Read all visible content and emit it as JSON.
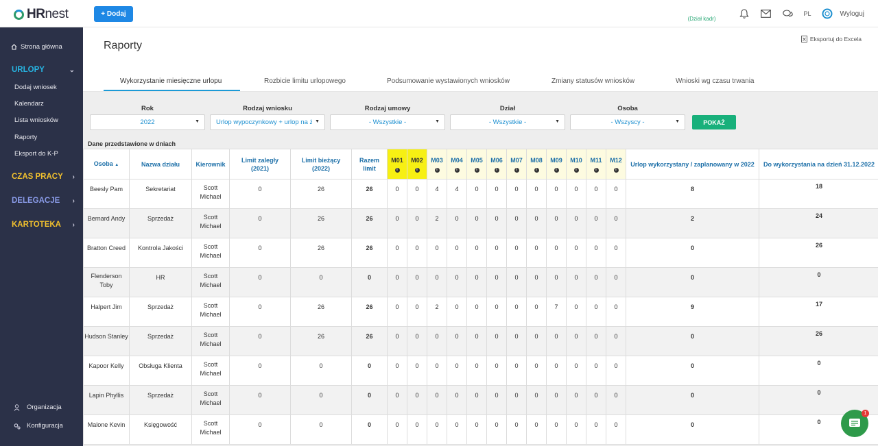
{
  "header": {
    "logo_bold": "HR",
    "logo_thin": "nest",
    "add_label": "+ Dodaj",
    "dzial_kadr": "(Dział kadr)",
    "lang": "PL",
    "logout": "Wyloguj"
  },
  "sidebar": {
    "home": "Strona główna",
    "urlopy": "URLOPY",
    "urlopy_items": [
      "Dodaj wniosek",
      "Kalendarz",
      "Lista wniosków",
      "Raporty",
      "Eksport do K-P"
    ],
    "czas_pracy": "CZAS PRACY",
    "delegacje": "DELEGACJE",
    "kartoteka": "KARTOTEKA",
    "organizacja": "Organizacja",
    "konfiguracja": "Konfiguracja"
  },
  "page": {
    "title": "Raporty",
    "export": "Eksportuj do Excela"
  },
  "tabs": [
    "Wykorzystanie miesięczne urlopu",
    "Rozbicie limitu urlopowego",
    "Podsumowanie wystawionych wniosków",
    "Zmiany statusów wniosków",
    "Wnioski wg czasu trwania"
  ],
  "filters": {
    "rok_label": "Rok",
    "rok_value": "2022",
    "rodzaj_wniosku_label": "Rodzaj wniosku",
    "rodzaj_wniosku_value": "Urlop wypoczynkowy + urlop na żą",
    "rodzaj_umowy_label": "Rodzaj umowy",
    "rodzaj_umowy_value": "- Wszystkie -",
    "dzial_label": "Dział",
    "dzial_value": "- Wszystkie -",
    "osoba_label": "Osoba",
    "osoba_value": "- Wszyscy -",
    "show_button": "POKAŻ"
  },
  "dane_label": "Dane przedstawione w dniach",
  "table": {
    "headers": {
      "osoba": "Osoba",
      "dzial": "Nazwa działu",
      "kierownik": "Kierownik",
      "limit_zalegly": "Limit zaległy",
      "limit_zalegly_year": "(2021)",
      "limit_biezacy": "Limit bieżący",
      "limit_biezacy_year": "(2022)",
      "razem": "Razem",
      "razem2": "limit",
      "months": [
        "M01",
        "M02",
        "M03",
        "M04",
        "M05",
        "M06",
        "M07",
        "M08",
        "M09",
        "M10",
        "M11",
        "M12"
      ],
      "wykorzystany": "Urlop wykorzystany / zaplanowany w 2022",
      "do_wykorzystania": "Do wykorzystania na dzień 31.12.2022"
    },
    "rows": [
      {
        "osoba": [
          "Beesly Pam"
        ],
        "dzial": "Sekretariat",
        "kier": [
          "Scott",
          "Michael"
        ],
        "lz": "0",
        "lb": "26",
        "razem": "26",
        "m": [
          "0",
          "0",
          "4",
          "4",
          "0",
          "0",
          "0",
          "0",
          "0",
          "0",
          "0",
          "0"
        ],
        "wyk": "8",
        "do": "18"
      },
      {
        "osoba": [
          "Bernard Andy"
        ],
        "dzial": "Sprzedaż",
        "kier": [
          "Scott",
          "Michael"
        ],
        "lz": "0",
        "lb": "26",
        "razem": "26",
        "m": [
          "0",
          "0",
          "2",
          "0",
          "0",
          "0",
          "0",
          "0",
          "0",
          "0",
          "0",
          "0"
        ],
        "wyk": "2",
        "do": "24"
      },
      {
        "osoba": [
          "Bratton Creed"
        ],
        "dzial": "Kontrola Jakości",
        "kier": [
          "Scott",
          "Michael"
        ],
        "lz": "0",
        "lb": "26",
        "razem": "26",
        "m": [
          "0",
          "0",
          "0",
          "0",
          "0",
          "0",
          "0",
          "0",
          "0",
          "0",
          "0",
          "0"
        ],
        "wyk": "0",
        "do": "26"
      },
      {
        "osoba": [
          "Flenderson",
          "Toby"
        ],
        "dzial": "HR",
        "kier": [
          "Scott",
          "Michael"
        ],
        "lz": "0",
        "lb": "0",
        "razem": "0",
        "m": [
          "0",
          "0",
          "0",
          "0",
          "0",
          "0",
          "0",
          "0",
          "0",
          "0",
          "0",
          "0"
        ],
        "wyk": "0",
        "do": "0"
      },
      {
        "osoba": [
          "Halpert Jim"
        ],
        "dzial": "Sprzedaż",
        "kier": [
          "Scott",
          "Michael"
        ],
        "lz": "0",
        "lb": "26",
        "razem": "26",
        "m": [
          "0",
          "0",
          "2",
          "0",
          "0",
          "0",
          "0",
          "0",
          "7",
          "0",
          "0",
          "0"
        ],
        "wyk": "9",
        "do": "17"
      },
      {
        "osoba": [
          "Hudson Stanley"
        ],
        "dzial": "Sprzedaż",
        "kier": [
          "Scott",
          "Michael"
        ],
        "lz": "0",
        "lb": "26",
        "razem": "26",
        "m": [
          "0",
          "0",
          "0",
          "0",
          "0",
          "0",
          "0",
          "0",
          "0",
          "0",
          "0",
          "0"
        ],
        "wyk": "0",
        "do": "26"
      },
      {
        "osoba": [
          "Kapoor Kelly"
        ],
        "dzial": "Obsługa Klienta",
        "kier": [
          "Scott",
          "Michael"
        ],
        "lz": "0",
        "lb": "0",
        "razem": "0",
        "m": [
          "0",
          "0",
          "0",
          "0",
          "0",
          "0",
          "0",
          "0",
          "0",
          "0",
          "0",
          "0"
        ],
        "wyk": "0",
        "do": "0"
      },
      {
        "osoba": [
          "Lapin Phyllis"
        ],
        "dzial": "Sprzedaż",
        "kier": [
          "Scott",
          "Michael"
        ],
        "lz": "0",
        "lb": "0",
        "razem": "0",
        "m": [
          "0",
          "0",
          "0",
          "0",
          "0",
          "0",
          "0",
          "0",
          "0",
          "0",
          "0",
          "0"
        ],
        "wyk": "0",
        "do": "0"
      },
      {
        "osoba": [
          "Malone Kevin"
        ],
        "dzial": "Księgowość",
        "kier": [
          "Scott",
          "Michael"
        ],
        "lz": "0",
        "lb": "0",
        "razem": "0",
        "m": [
          "0",
          "0",
          "0",
          "0",
          "0",
          "0",
          "0",
          "0",
          "0",
          "0",
          "0",
          "0"
        ],
        "wyk": "0",
        "do": "0"
      }
    ]
  },
  "chat_badge": "1"
}
